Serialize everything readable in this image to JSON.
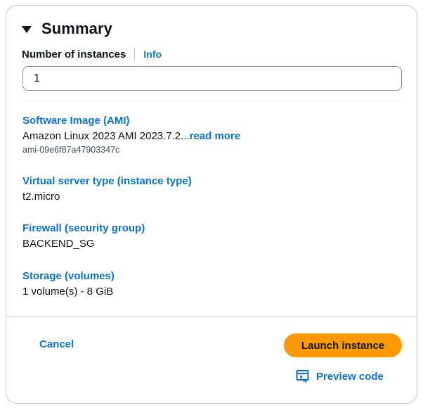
{
  "summary": {
    "title": "Summary",
    "number_of_instances_label": "Number of instances",
    "info_link": "Info",
    "number_of_instances_value": "1"
  },
  "software_image": {
    "title": "Software Image (AMI)",
    "value": "Amazon Linux 2023 AMI 2023.7.2...",
    "read_more": "read more",
    "ami_id": "ami-09e6f87a47903347c"
  },
  "instance_type": {
    "title": "Virtual server type (instance type)",
    "value": "t2.micro"
  },
  "firewall": {
    "title": "Firewall (security group)",
    "value": "BACKEND_SG"
  },
  "storage": {
    "title": "Storage (volumes)",
    "value": "1 volume(s) - 8 GiB"
  },
  "actions": {
    "cancel": "Cancel",
    "launch": "Launch instance",
    "preview_code": "Preview code",
    "preview_icon": "code-preview-icon"
  },
  "colors": {
    "link": "#0972d3",
    "primary_button": "#ff9900",
    "text": "#0f141a",
    "border": "#c6c6cd"
  }
}
